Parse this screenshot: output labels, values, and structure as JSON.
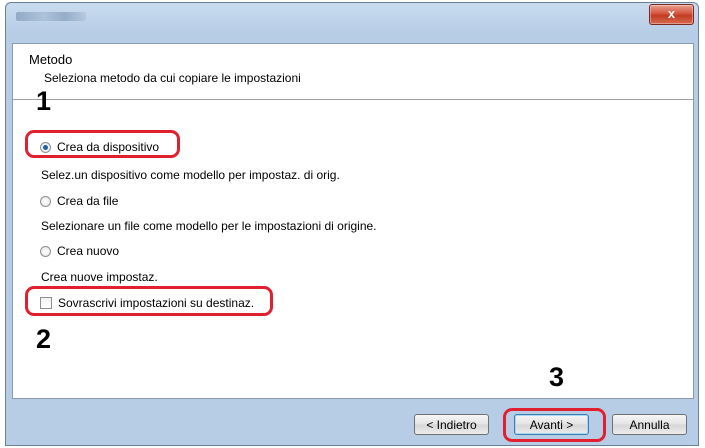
{
  "window": {
    "close_glyph": "x"
  },
  "header": {
    "title": "Metodo",
    "subtitle": "Seleziona metodo da cui copiare le impostazioni"
  },
  "options": [
    {
      "label": "Crea da dispositivo",
      "description": "Selez.un dispositivo come modello per impostaz. di orig.",
      "selected": true
    },
    {
      "label": "Crea da file",
      "description": "Selezionare un file come modello per le impostazioni di origine.",
      "selected": false
    },
    {
      "label": "Crea nuovo",
      "description": "Crea nuove impostaz.",
      "selected": false
    }
  ],
  "overwrite_checkbox": {
    "label": "Sovrascrivi impostazioni su destinaz.",
    "checked": false
  },
  "buttons": {
    "back": "< Indietro",
    "next": "Avanti >",
    "cancel": "Annulla"
  },
  "steps": [
    "1",
    "2",
    "3"
  ],
  "colors": {
    "highlight": "#e0202f",
    "selected_radio": "#1f5fa8"
  }
}
